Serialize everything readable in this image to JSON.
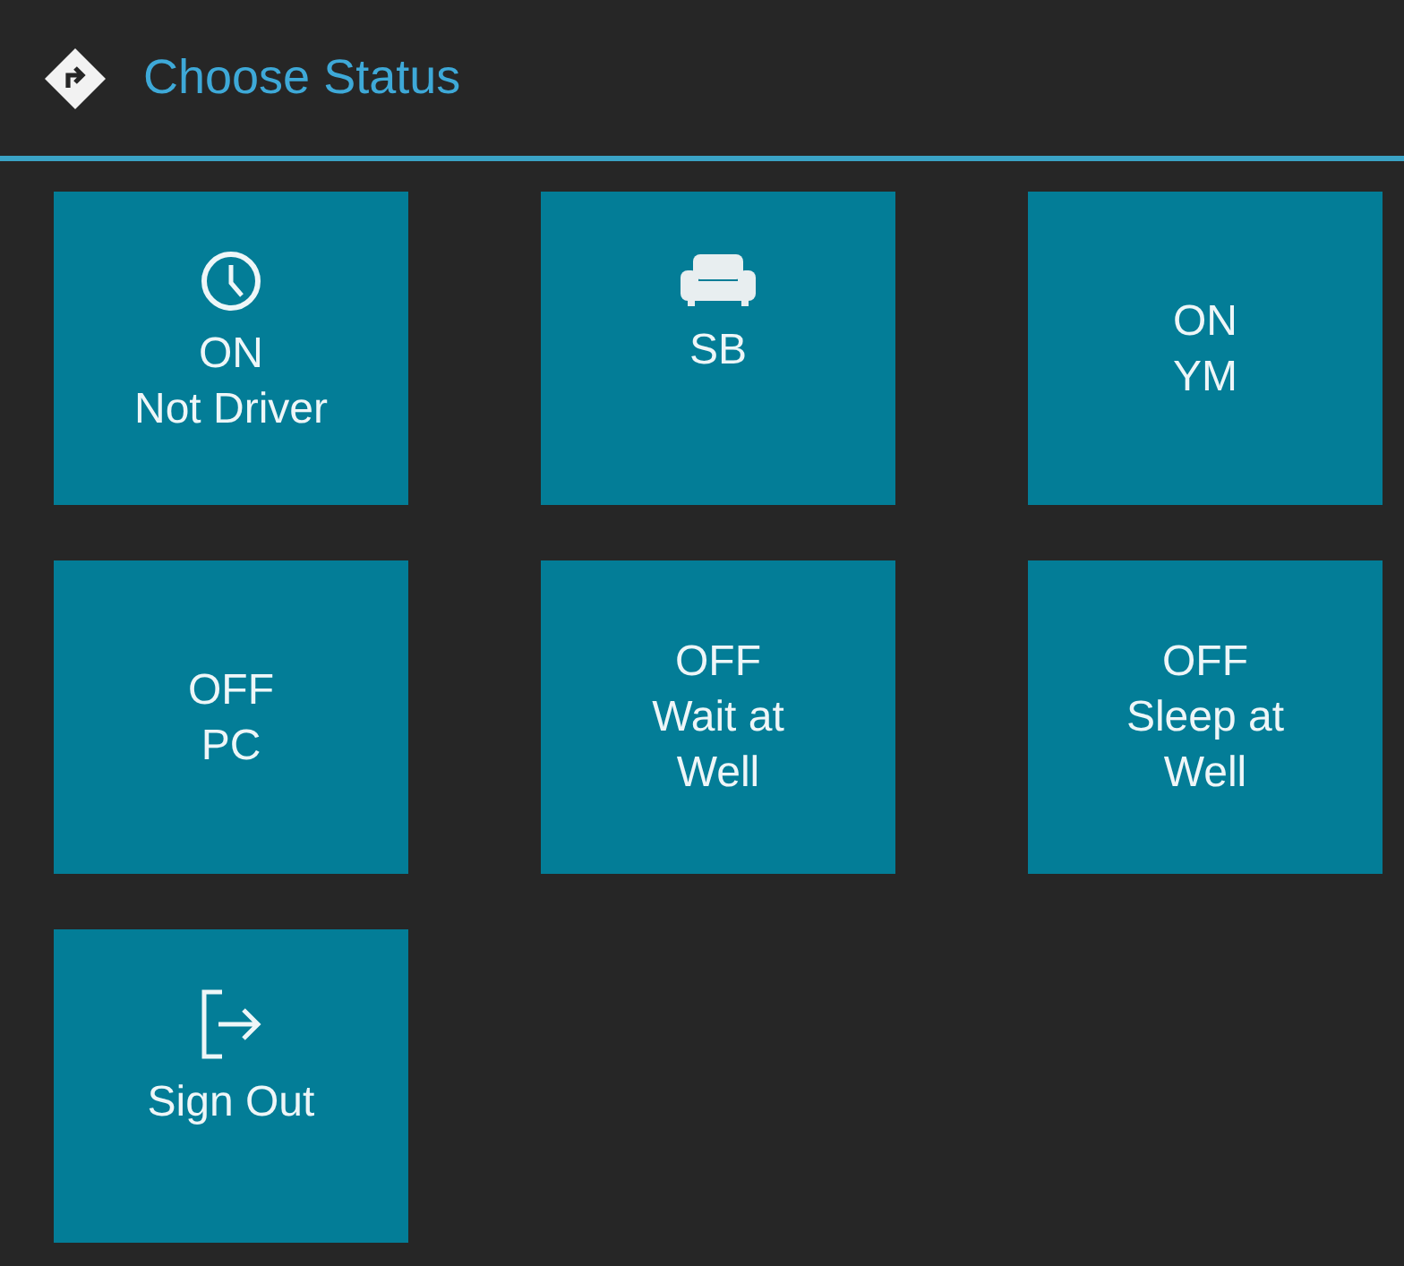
{
  "header": {
    "title": "Choose Status"
  },
  "tiles": [
    {
      "label": "ON\nNot Driver",
      "kind": "clock"
    },
    {
      "label": "SB",
      "kind": "sofa"
    },
    {
      "label": "ON\nYM"
    },
    {
      "label": "OFF\nPC"
    },
    {
      "label": "OFF\nWait at\nWell"
    },
    {
      "label": "OFF\nSleep at\nWell"
    },
    {
      "label": "Sign Out",
      "kind": "exit"
    }
  ]
}
